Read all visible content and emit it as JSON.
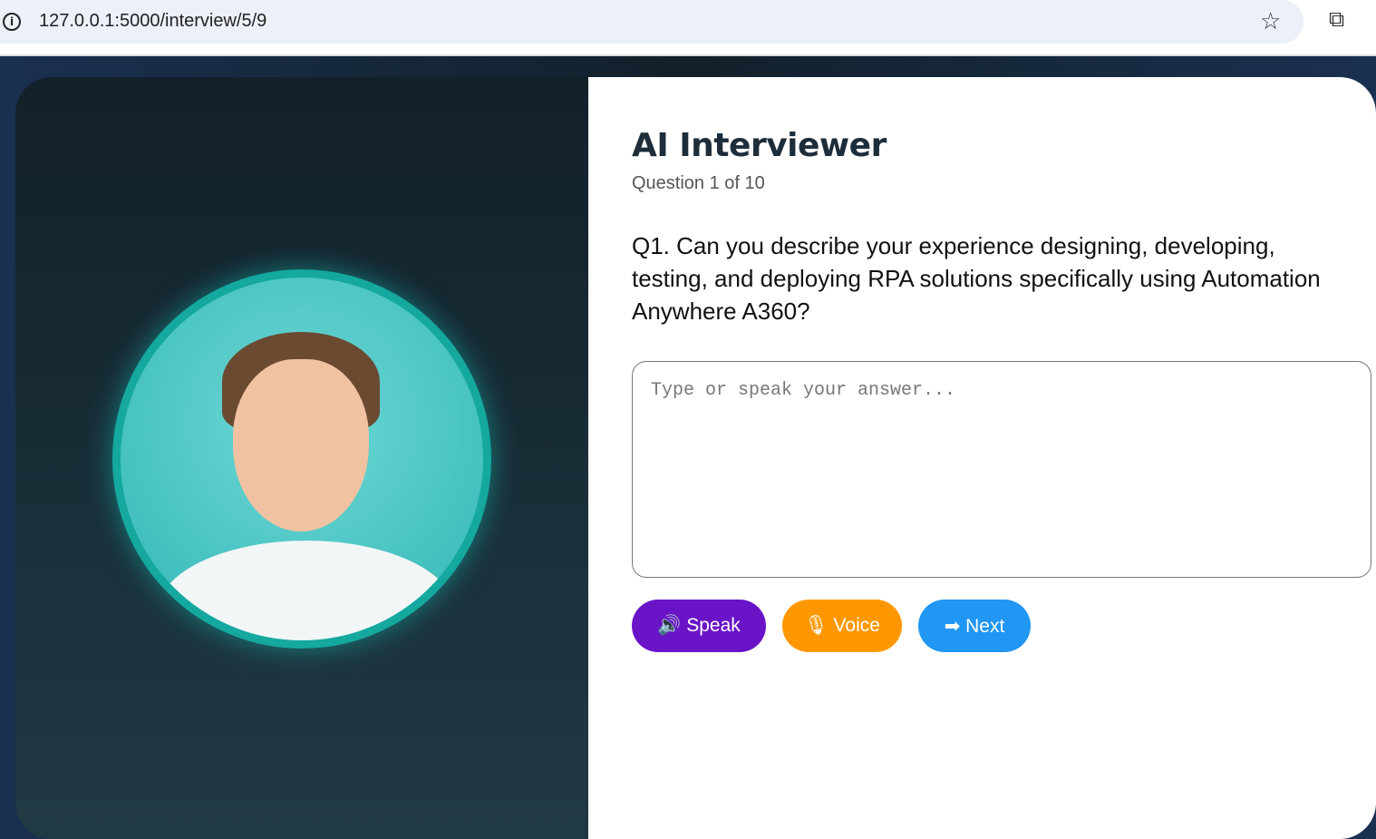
{
  "browser": {
    "url": "127.0.0.1:5000/interview/5/9"
  },
  "main": {
    "title": "AI Interviewer",
    "progress": "Question 1 of 10",
    "question": "Q1. Can you describe your experience designing, developing, testing, and deploying RPA solutions specifically using Automation Anywhere A360?",
    "answer_placeholder": "Type or speak your answer...",
    "answer_value": ""
  },
  "buttons": {
    "speak": "🔊 Speak",
    "voice": "🎙 Voice",
    "next": "➡ Next"
  },
  "colors": {
    "speak": "#6a14c8",
    "voice": "#ff9800",
    "next": "#2196f3",
    "ring": "#14a89f"
  }
}
